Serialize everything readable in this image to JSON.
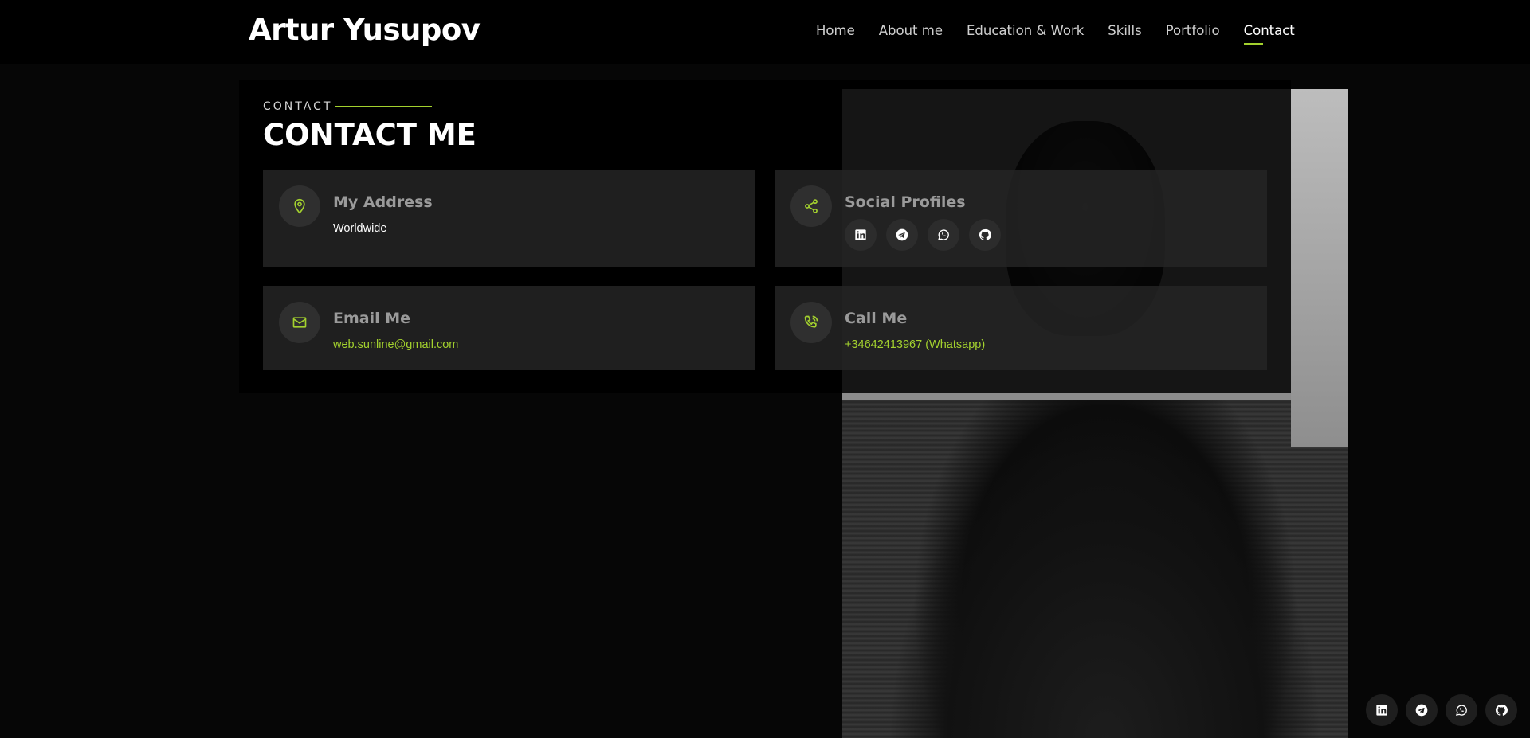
{
  "header": {
    "brand": "Artur Yusupov",
    "nav": [
      {
        "label": "Home"
      },
      {
        "label": "About me"
      },
      {
        "label": "Education & Work"
      },
      {
        "label": "Skills"
      },
      {
        "label": "Portfolio"
      },
      {
        "label": "Contact",
        "active": true
      }
    ]
  },
  "section": {
    "kicker": "CONTACT",
    "title": "CONTACT ME"
  },
  "cards": {
    "address": {
      "title": "My Address",
      "text": "Worldwide",
      "icon": "map-pin-icon"
    },
    "social": {
      "title": "Social Profiles",
      "icon": "share-icon",
      "links": [
        "linkedin-icon",
        "telegram-icon",
        "whatsapp-icon",
        "github-icon"
      ]
    },
    "email": {
      "title": "Email Me",
      "text": "web.sunline@gmail.com",
      "icon": "mail-icon"
    },
    "call": {
      "title": "Call Me",
      "text": "+34642413967 (Whatsapp)",
      "icon": "phone-icon"
    }
  },
  "floating_social": [
    "linkedin-icon",
    "telegram-icon",
    "whatsapp-icon",
    "github-icon"
  ],
  "colors": {
    "accent": "#a3d12e",
    "background": "#060606",
    "card": "#262626"
  }
}
